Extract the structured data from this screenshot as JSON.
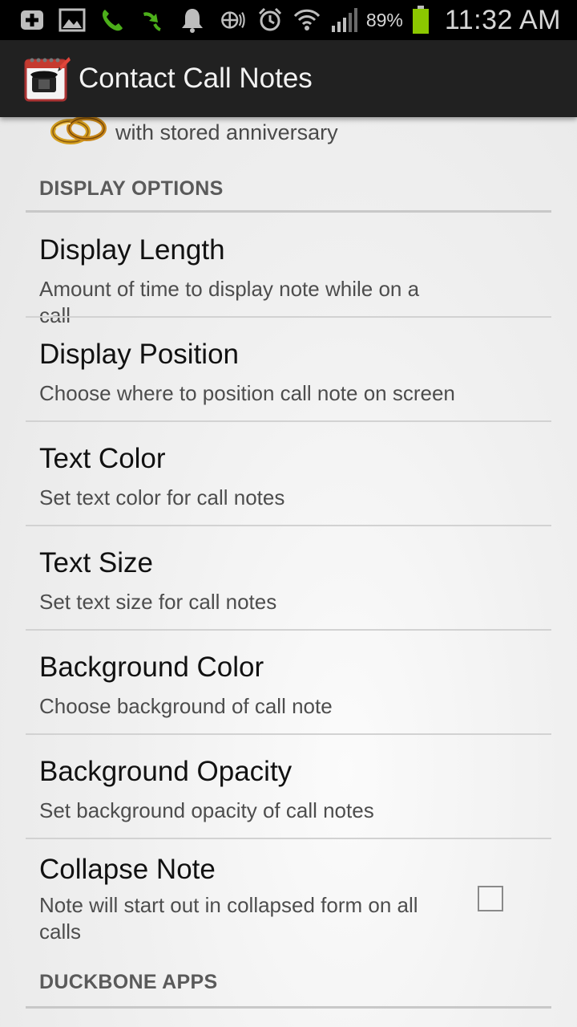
{
  "status_bar": {
    "icons": [
      "plus-icon",
      "image-icon",
      "call-icon",
      "missed-call-icon",
      "bell-icon",
      "sync-icon",
      "alarm-icon",
      "wifi-icon",
      "signal-icon"
    ],
    "battery": "89%",
    "time": "11:32 AM",
    "battery_color": "#8cc800"
  },
  "action_bar": {
    "title": "Contact Call Notes",
    "icon": "notepad-phone-icon"
  },
  "partial_item": {
    "icon": "wedding-rings-icon",
    "summary": "with stored anniversary"
  },
  "categories": {
    "display_options": "DISPLAY OPTIONS",
    "duckbone_apps": "DUCKBONE APPS"
  },
  "prefs": [
    {
      "title": "Display Length",
      "summary": "Amount of time to display note while on a call"
    },
    {
      "title": "Display Position",
      "summary": "Choose where to position call note on screen"
    },
    {
      "title": "Text Color",
      "summary": "Set text color for call notes"
    },
    {
      "title": "Text Size",
      "summary": "Set text size for call notes"
    },
    {
      "title": "Background Color",
      "summary": "Choose background of call note"
    },
    {
      "title": "Background Opacity",
      "summary": "Set background opacity of call notes"
    },
    {
      "title": "Collapse Note",
      "summary": "Note will start out in collapsed form on all calls",
      "checked": false
    }
  ]
}
